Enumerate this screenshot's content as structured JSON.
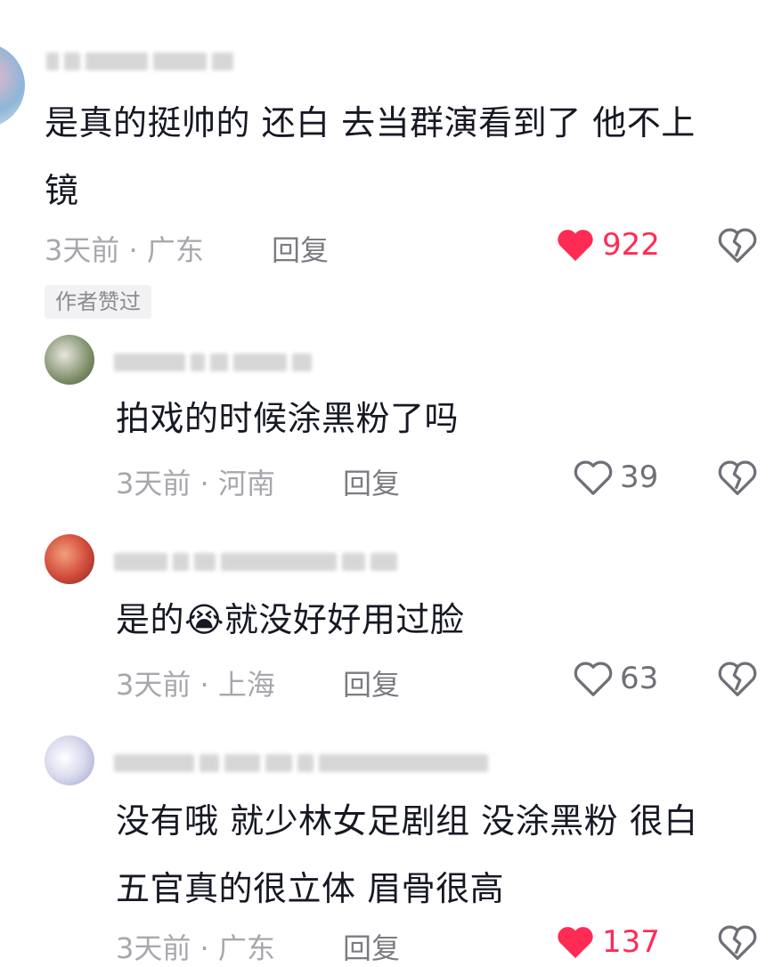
{
  "comments": [
    {
      "text_lines": [
        "是真的挺帅的 还白 去当群演看到了 他不上",
        "镜"
      ],
      "time_location": "3天前 · 广东",
      "reply_label": "回复",
      "likes": "922",
      "liked": true,
      "author_badge": "作者赞过"
    },
    {
      "text_lines": [
        "拍戏的时候涂黑粉了吗"
      ],
      "time_location": "3天前 · 河南",
      "reply_label": "回复",
      "likes": "39",
      "liked": false
    },
    {
      "text_lines": [
        "是的😭就没好好用过脸"
      ],
      "time_location": "3天前 · 上海",
      "reply_label": "回复",
      "likes": "63",
      "liked": false
    },
    {
      "text_lines": [
        "没有哦 就少林女足剧组 没涂黑粉 很白",
        "五官真的很立体 眉骨很高"
      ],
      "time_location": "3天前 · 广东",
      "reply_label": "回复",
      "likes": "137",
      "liked": true
    }
  ],
  "colors": {
    "accent": "#fe2c55",
    "meta": "#a7a8ad",
    "text": "#161823"
  },
  "icons": {
    "like": "heart-icon",
    "dislike": "broken-heart-icon"
  }
}
